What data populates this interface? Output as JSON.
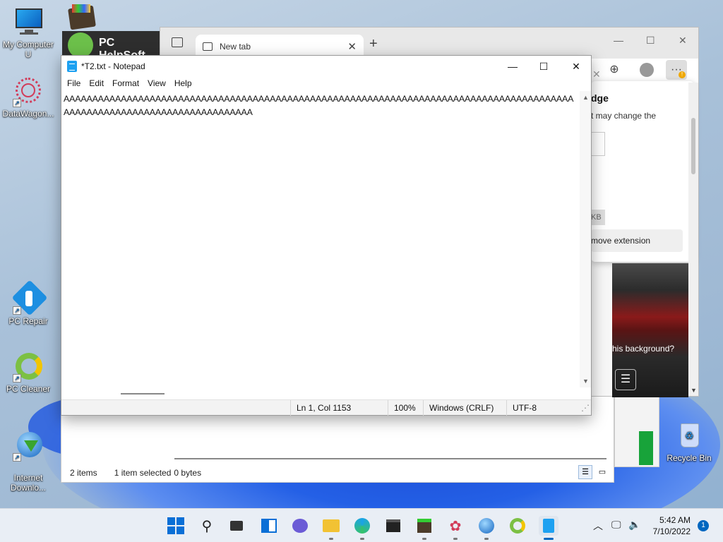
{
  "desktop": {
    "icons": [
      {
        "label": "My Computer U"
      },
      {
        "label": "DataWagon..."
      },
      {
        "label": "PC Repair"
      },
      {
        "label": "PC Cleaner"
      },
      {
        "label": "Internet\nDownlo..."
      },
      {
        "label": "Recycle Bin"
      }
    ],
    "helpsoft_label": "PC HelpSoft"
  },
  "explorer": {
    "items_count": "2 items",
    "selected": "1 item selected",
    "size": "0 bytes"
  },
  "edge": {
    "tab_label": "New tab",
    "flyout_title": "dge",
    "flyout_desc": "t may change the",
    "remove_label": "move extension",
    "kb_label": "KB",
    "bg_question": "his background?"
  },
  "notepad": {
    "title": "*T2.txt - Notepad",
    "menu": [
      "File",
      "Edit",
      "Format",
      "View",
      "Help"
    ],
    "content": "AAAAAAAAAAAAAAAAAAAAAAAAAAAAAAAAAAAAAAAAAAAAAAAAAAAAAAAAAAAAAAAAAAAAAAAAAAAAAAAAAAAAAAAAAAAAAAAAAAAAAAAAAAAAAAAAAAAAAAAAAA",
    "status": {
      "position": "Ln 1, Col 1153",
      "zoom": "100%",
      "line_ending": "Windows (CRLF)",
      "encoding": "UTF-8"
    }
  },
  "taskbar": {
    "time": "5:42 AM",
    "date": "7/10/2022",
    "notification_count": "1"
  }
}
